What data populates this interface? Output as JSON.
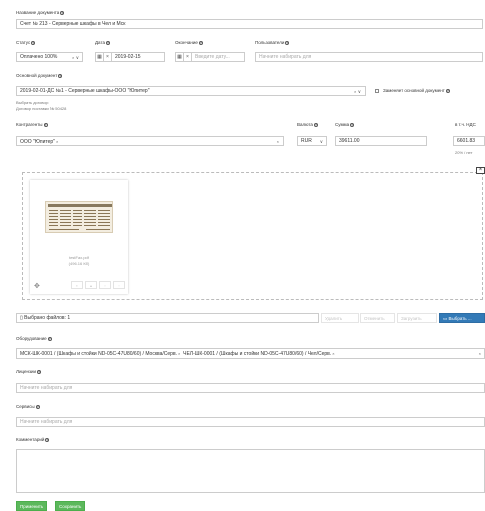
{
  "doc_name": {
    "label": "Название документа",
    "value": "Счет № 213 - Серверные шкафы в Чел и Мск"
  },
  "status": {
    "label": "Статус",
    "value": "Оплачено 100%"
  },
  "date": {
    "label": "Дата",
    "value": "2019-02-15"
  },
  "end_date": {
    "label": "Окончание",
    "placeholder": "Введите дату..."
  },
  "users": {
    "label": "Пользователи",
    "placeholder": "Начните набирать для"
  },
  "base_doc": {
    "label": "Основной документ",
    "value": "2019-02-01-ДС №1 - Серверные шкафы-ООО \"Юпитер\"",
    "replace_label": "Заменяет основной документ",
    "hint1": "Выбрать договор:",
    "hint2": "Договор поставки № 50428"
  },
  "counterparties": {
    "label": "Контрагенты",
    "value": "ООО \"Юпитер\""
  },
  "currency": {
    "label": "Валюта",
    "value": "RUR"
  },
  "amount": {
    "label": "Сумма",
    "value": "39611.00"
  },
  "vat": {
    "label": "в т.ч. НДС",
    "value": "6601.83",
    "rate": "20% / нет"
  },
  "file": {
    "name": "testFax.pdf",
    "size": "(496.16 Кб)"
  },
  "files_bar": {
    "selected_text": "Выбрано файлов: 1",
    "delete_label": "Удалить",
    "cancel_label": "Отменить",
    "upload_label": "Загрузить",
    "browse_label": "Выбрать ..."
  },
  "equipment": {
    "label": "Оборудование",
    "tags": [
      "МСК-ШК-0001 / (Шкафы и стойки ND-05C-47U80/60) / Москва/Серв.",
      "ЧЕЛ-ШК-0001 / (Шкафы и стойки ND-05C-47U80/60) / Чел/Серв."
    ]
  },
  "licenses": {
    "label": "Лицензии",
    "placeholder": "Начните набирать для"
  },
  "services": {
    "label": "Сервисы",
    "placeholder": "Начните набирать для"
  },
  "comment": {
    "label": "Комментарий"
  },
  "actions": {
    "apply_label": "Применить",
    "save_label": "Сохранить"
  },
  "icons": {
    "help": "question-circle-icon",
    "calendar": "calendar-icon",
    "clear": "times-icon",
    "caret": "chevron-down-icon",
    "file": "file-icon",
    "folder": "folder-open-icon",
    "move": "move-icon",
    "close": "close-icon"
  },
  "colors": {
    "green": "#5cb85c",
    "primary": "#337ab7"
  }
}
